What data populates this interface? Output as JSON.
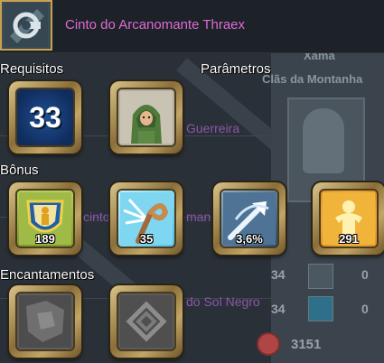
{
  "tooltip": {
    "item_name": "Cinto do Arcanomante Thraex",
    "item_icon": "belt-icon",
    "sections": {
      "requirements": "Requisitos",
      "parameters": "Parâmetros",
      "bonus": "Bônus",
      "enchantments": "Encantamentos"
    },
    "requirement_level": "33",
    "bonus_values": {
      "armor": "189",
      "magic_attack": "35",
      "critical": "3,6%",
      "health": "291"
    }
  },
  "background": {
    "class_name": "Xamã",
    "clan_name": "Clãs da Montanha",
    "text_warrior": "Guerreira",
    "text_cinto": "cinto",
    "text_man": "man",
    "text_sol_negro": "do Sol Negro",
    "stat_a": "34",
    "stat_b": "0",
    "stat_c": "34",
    "stat_d": "0",
    "hp_value": "3151"
  },
  "colors": {
    "item_name": "#e06ad6",
    "frame_gold": "#c9a24f",
    "level_bg": "#12366e"
  }
}
